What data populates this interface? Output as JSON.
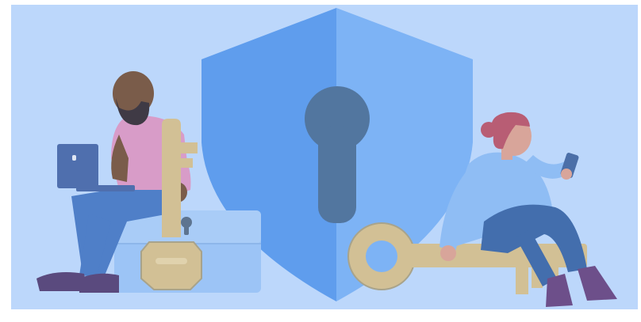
{
  "illustration": {
    "subject": "security-illustration",
    "elements": [
      "shield-icon",
      "keyhole-icon",
      "key-icon",
      "lock-box-icon",
      "laptop-icon",
      "phone-icon",
      "person-icon"
    ],
    "colors": {
      "frame": "#ffffff",
      "background": "#bcd7fb",
      "shield_left": "#5f9ded",
      "shield_right": "#7db3f5",
      "keyhole": "#52769f",
      "key": "#d2c095",
      "key_outline": "#a8a38b",
      "box": "#9cc4f6",
      "box_lid": "#a9ccf7",
      "lock": "#5d7490",
      "man_skin": "#7a5c4a",
      "man_beard": "#3f3a45",
      "man_shirt": "#d89cc8",
      "man_pants": "#4f7fc8",
      "man_shoes": "#5a4a7e",
      "laptop": "#4f6fae",
      "woman_skin": "#d8a59a",
      "woman_hair": "#b85d74",
      "woman_shirt": "#8fbdf4",
      "woman_pants": "#436ead",
      "woman_shoes": "#6d4f8a",
      "phone": "#4b6fa8"
    }
  }
}
